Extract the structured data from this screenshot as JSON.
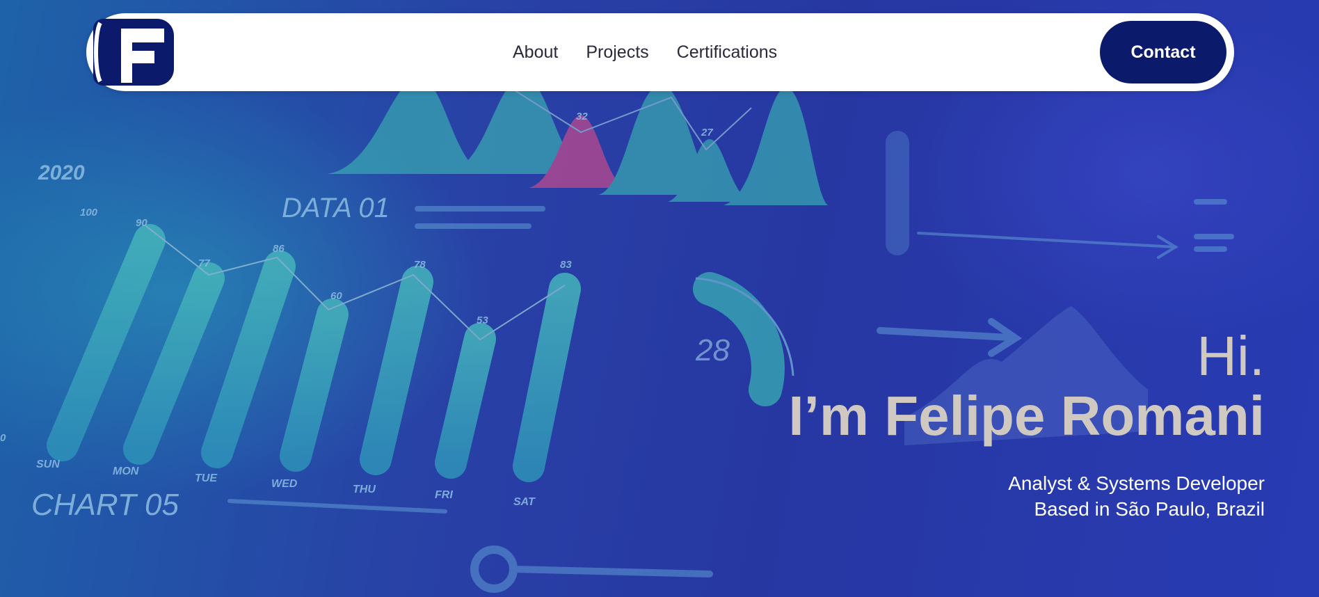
{
  "nav": {
    "logo_letter": "F",
    "links": [
      "About",
      "Projects",
      "Certifications"
    ],
    "contact_label": "Contact"
  },
  "hero": {
    "greeting": "Hi.",
    "name": "I’m Felipe Romani",
    "role": "Analyst & Systems Developer",
    "location": "Based in São Paulo, Brazil"
  },
  "background_labels": {
    "year": "2020",
    "data_title": "DATA 01",
    "chart_title": "CHART 05",
    "gauge_value": "28",
    "days": [
      "SUN",
      "MON",
      "TUE",
      "WED",
      "THU",
      "FRI",
      "SAT"
    ],
    "bar_values": [
      "90",
      "77",
      "86",
      "60",
      "78",
      "53",
      "83"
    ],
    "top_values": [
      "32",
      "27"
    ],
    "axis_top": "100",
    "axis_zero": "0"
  },
  "colors": {
    "brand_dark": "#0b1a6a",
    "hero_text": "#cfc9c2",
    "accent_teal": "#3fc3bd",
    "accent_pink": "#e0508f"
  }
}
